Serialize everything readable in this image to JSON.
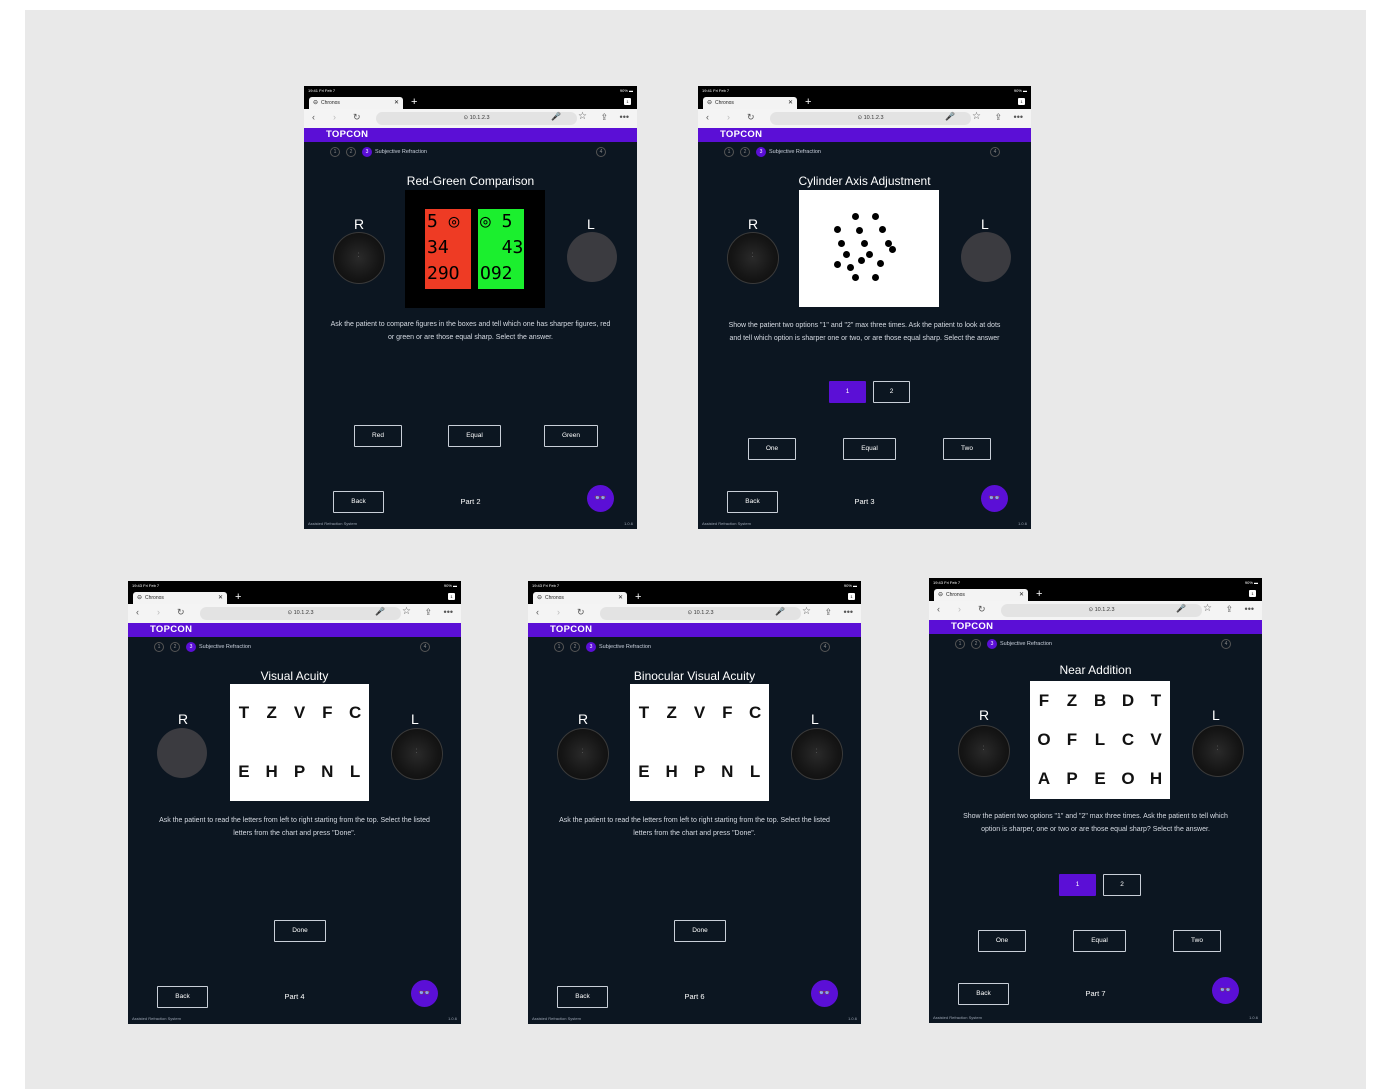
{
  "browser": {
    "status_time": "19:41  Fri Feb 7",
    "battery": "90% ▬",
    "tab_title": "Chronos",
    "tab_count": "1",
    "address": "⊙ 10.1.2.3",
    "status_time_b": "19:43  Fri Feb 7"
  },
  "brand": "TOPCON",
  "wizard": {
    "step1": "1",
    "step2": "2",
    "step3": "3",
    "step4": "4",
    "step_label": "Subjective Refraction"
  },
  "labels": {
    "right_eye": "R",
    "left_eye": "L",
    "back": "Back",
    "footer": "Assisted Refraction System",
    "version": "1.0.6"
  },
  "screens": [
    {
      "title": "Red-Green Comparison",
      "instruction": "Ask the patient to compare figures in the boxes and tell which one has sharper figures, red or green or are those equal sharp. Select the answer.",
      "red_figures": [
        "5 ◎",
        "34",
        "29O"
      ],
      "green_figures": [
        "◎ 5",
        "  43",
        "O92"
      ],
      "buttons": [
        "Red",
        "Equal",
        "Green"
      ],
      "part": "Part 2"
    },
    {
      "title": "Cylinder Axis Adjustment",
      "instruction": "Show the patient two options \"1\" and \"2\" max three times. Ask the patient to look at dots and tell which option is sharper one or two, or are those equal sharp. Select the answer",
      "options": [
        "1",
        "2"
      ],
      "buttons": [
        "One",
        "Equal",
        "Two"
      ],
      "part": "Part 3"
    },
    {
      "title": "Visual Acuity",
      "instruction": "Ask the patient to read the letters from left to right starting from the top. Select the listed letters from the chart and press \"Done\".",
      "letters": [
        "T",
        "Z",
        "V",
        "F",
        "C",
        "E",
        "H",
        "P",
        "N",
        "L"
      ],
      "done": "Done",
      "part": "Part 4"
    },
    {
      "title": "Binocular Visual Acuity",
      "instruction": "Ask the patient to read the letters from left to right starting from the top. Select the listed letters from the chart and press \"Done\".",
      "letters": [
        "T",
        "Z",
        "V",
        "F",
        "C",
        "E",
        "H",
        "P",
        "N",
        "L"
      ],
      "done": "Done",
      "part": "Part 6"
    },
    {
      "title": "Near Addition",
      "instruction": "Show the patient two options \"1\" and \"2\" max three times. Ask the patient to tell which option is sharper, one or two or are those equal sharp? Select the answer.",
      "letters": [
        "F",
        "Z",
        "B",
        "D",
        "T",
        "O",
        "F",
        "L",
        "C",
        "V",
        "A",
        "P",
        "E",
        "O",
        "H"
      ],
      "options": [
        "1",
        "2"
      ],
      "buttons": [
        "One",
        "Equal",
        "Two"
      ],
      "part": "Part 7"
    }
  ],
  "icons": {
    "fab": "binoculars-icon",
    "tab": "globe-icon"
  },
  "colors": {
    "brand": "#5b0fd6",
    "screen_bg": "#0c1621",
    "red": "#ee3b24",
    "green": "#1bef2e"
  }
}
